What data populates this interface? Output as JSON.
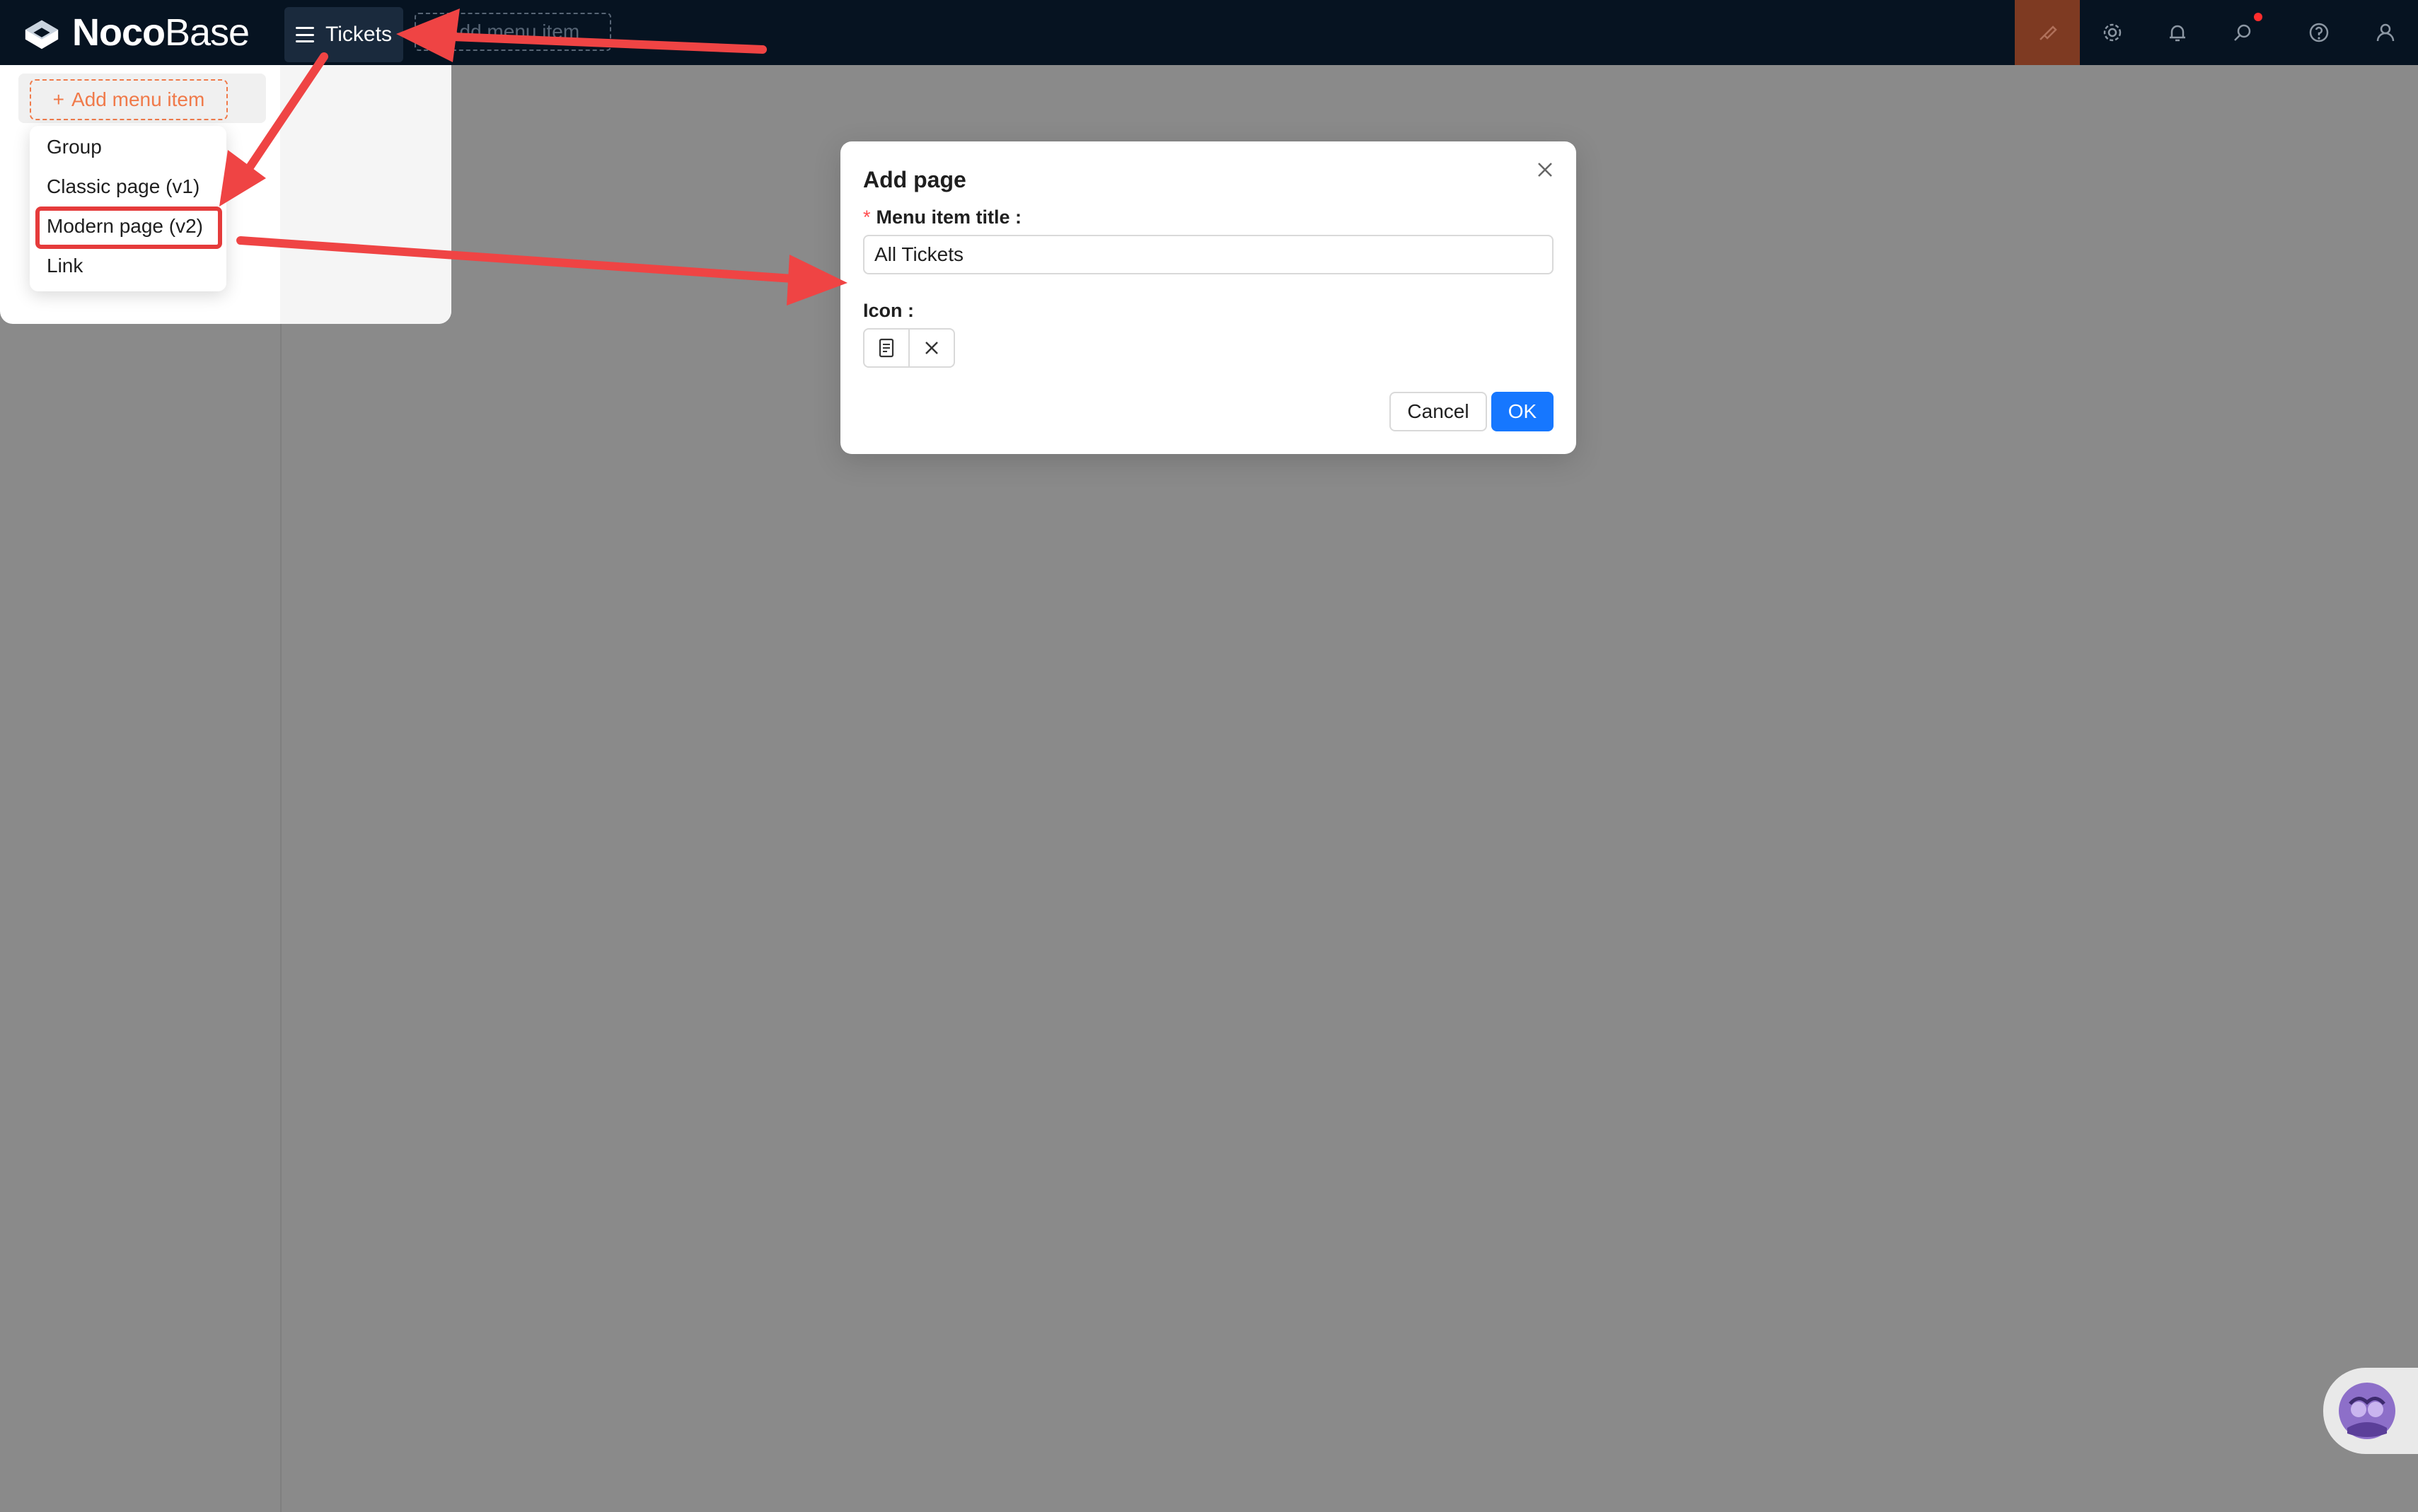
{
  "brand": {
    "name_bold": "Noco",
    "name_light": "Base"
  },
  "topbar": {
    "menu_tab_label": "Tickets",
    "ghost_add_label": "Add menu item",
    "tools": [
      "ui-editor-icon",
      "settings-icon",
      "bell-icon",
      "search-icon",
      "help-icon",
      "user-icon"
    ],
    "active_tool_color": "#7e3a22"
  },
  "sidebar": {
    "add_menu_item_label": "Add menu item",
    "menu_types": [
      "Group",
      "Classic page (v1)",
      "Modern page (v2)",
      "Link"
    ],
    "highlighted_item": "Modern page (v2)"
  },
  "modal": {
    "title": "Add page",
    "title_field_label": "Menu item title",
    "title_field_value": "All Tickets",
    "icon_field_label": "Icon",
    "selected_icon": "document-icon",
    "cancel_label": "Cancel",
    "ok_label": "OK"
  },
  "colors": {
    "topbar": "#061321",
    "accent_orange": "#f07a4a",
    "primary_blue": "#1677ff",
    "annotation_red": "#e53b3b",
    "required_red": "#ff4d4f"
  }
}
